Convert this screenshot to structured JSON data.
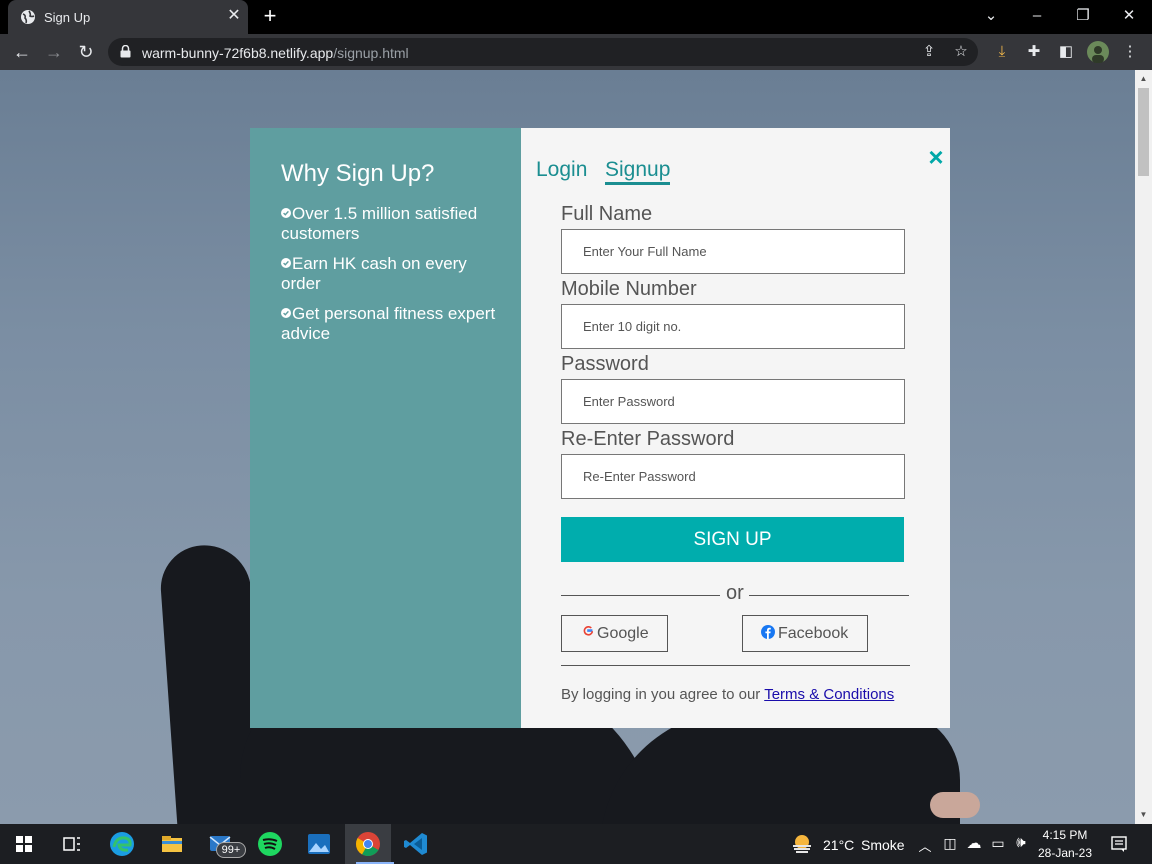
{
  "browser": {
    "tab_title": "Sign Up",
    "url_host": "warm-bunny-72f6b8.netlify.app",
    "url_path": "/signup.html"
  },
  "modal": {
    "heading": "Why Sign Up?",
    "benefits": [
      "Over 1.5 million satisfied customers",
      "Earn HK cash on every order",
      "Get personal fitness expert advice"
    ],
    "close_label": "×",
    "tabs": {
      "login": "Login",
      "signup": "Signup"
    },
    "fields": {
      "full_name": {
        "label": "Full Name",
        "placeholder": "Enter Your Full Name"
      },
      "mobile": {
        "label": "Mobile Number",
        "placeholder": "Enter 10 digit no."
      },
      "password": {
        "label": "Password",
        "placeholder": "Enter Password"
      },
      "reenter": {
        "label": "Re-Enter Password",
        "placeholder": "Re-Enter Password"
      }
    },
    "signup_button": "SIGN UP",
    "or_text": "or",
    "google_label": "Google",
    "facebook_label": "Facebook",
    "terms_prefix": "By logging in you agree to our ",
    "terms_link": "Terms & Conditions"
  },
  "colors": {
    "accent": "#00adad",
    "panel": "#5f9ea0",
    "link": "#1b8e91"
  },
  "taskbar": {
    "mail_badge": "99+",
    "temperature": "21°C",
    "weather": "Smoke",
    "time": "4:15 PM",
    "date": "28-Jan-23"
  }
}
